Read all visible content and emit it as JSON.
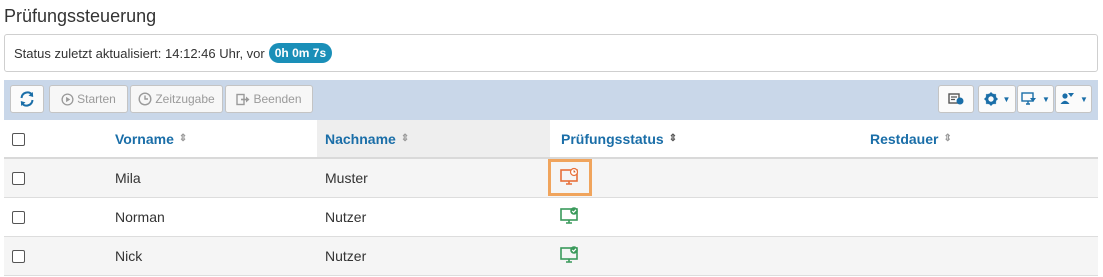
{
  "page": {
    "title": "Prüfungssteuerung"
  },
  "status": {
    "text": "Status zuletzt aktualisiert: 14:12:46 Uhr, vor",
    "elapsed": "0h 0m 7s"
  },
  "toolbar": {
    "refresh_icon": "refresh-icon",
    "start_label": "Starten",
    "timeadd_label": "Zeitzugabe",
    "end_label": "Beenden"
  },
  "table": {
    "columns": {
      "vorname": "Vorname",
      "nachname": "Nachname",
      "status": "Prüfungsstatus",
      "rest": "Restdauer"
    },
    "rows": [
      {
        "vorname": "Mila",
        "nachname": "Muster",
        "status": "waiting",
        "rest": ""
      },
      {
        "vorname": "Norman",
        "nachname": "Nutzer",
        "status": "ok",
        "rest": ""
      },
      {
        "vorname": "Nick",
        "nachname": "Nutzer",
        "status": "ok",
        "rest": ""
      }
    ]
  },
  "colors": {
    "accent": "#1a6ea8",
    "badge": "#1a8fb8",
    "status_waiting": "#e8703a",
    "status_ok": "#3a9a5b",
    "highlight": "#f0a45c"
  }
}
